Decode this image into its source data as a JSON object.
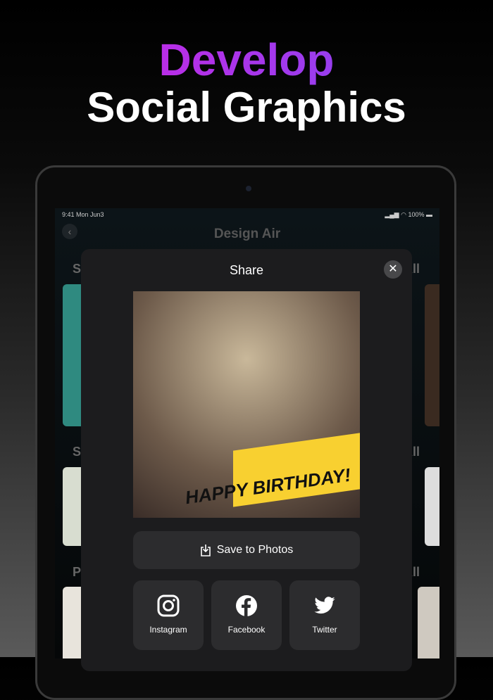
{
  "headline": {
    "line1": "Develop",
    "line2": "Social Graphics"
  },
  "status": {
    "time": "9:41  Mon Jun3",
    "battery": "100%"
  },
  "app": {
    "title": "Design Air",
    "sections": [
      "S",
      "S",
      "P"
    ],
    "see_all": "All"
  },
  "modal": {
    "title": "Share",
    "image_text": "HAPPY BIRTHDAY!",
    "save_label": "Save to Photos",
    "share_targets": [
      {
        "label": "Instagram",
        "icon": "instagram-icon"
      },
      {
        "label": "Facebook",
        "icon": "facebook-icon"
      },
      {
        "label": "Twitter",
        "icon": "twitter-icon"
      }
    ]
  }
}
